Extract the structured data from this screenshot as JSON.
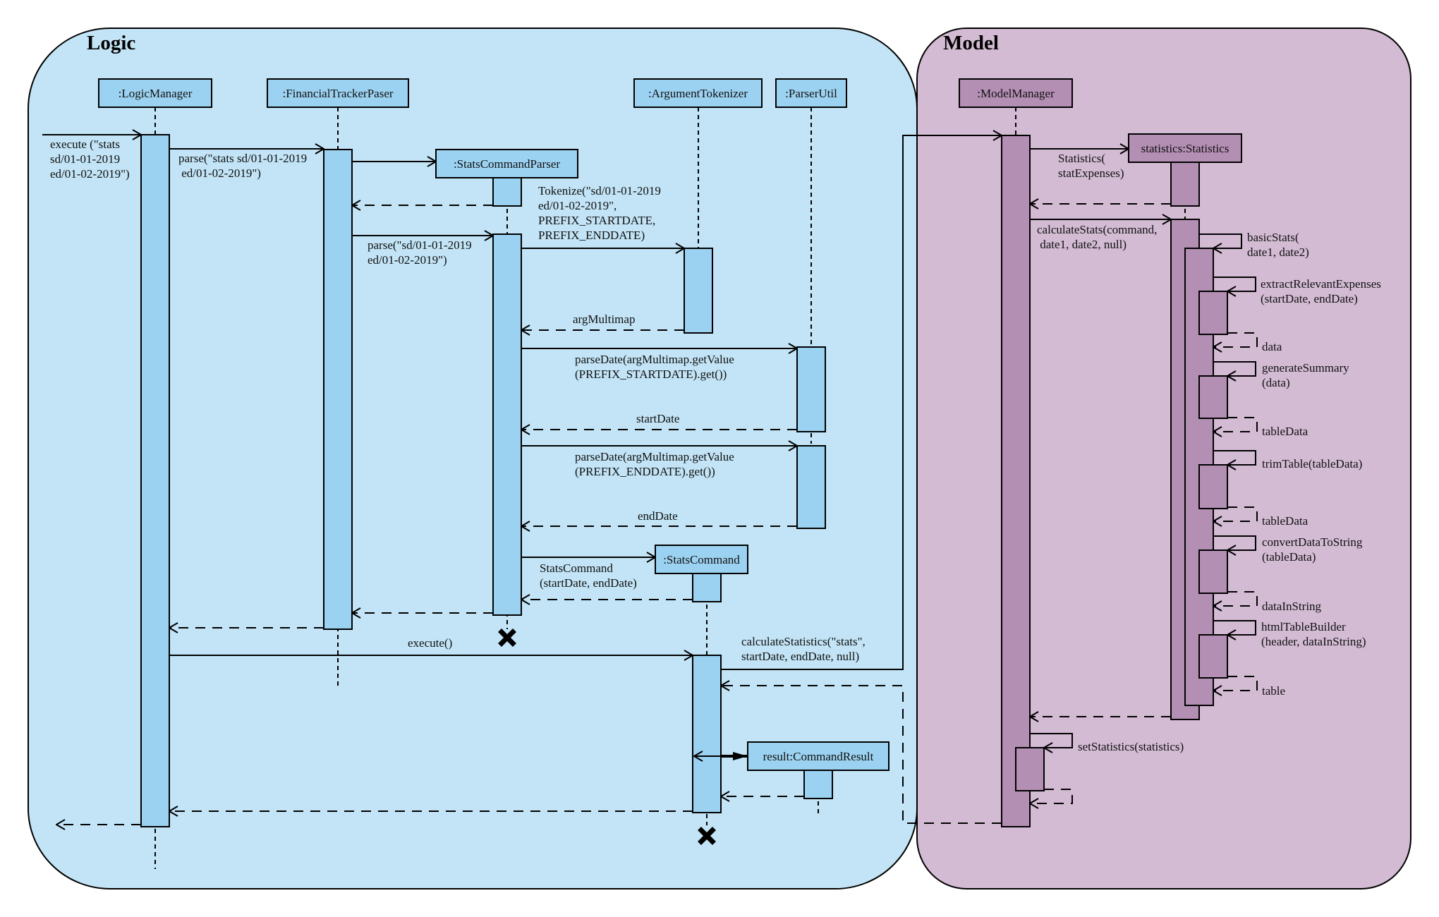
{
  "diagram": {
    "type": "sequence",
    "colors": {
      "logic_background": "#C2E4F6",
      "logic_element": "#9CD2F1",
      "model_background": "#D3BBD3",
      "model_element": "#B48FB4",
      "line": "#000000"
    },
    "frames": {
      "logic": {
        "title": "Logic"
      },
      "model": {
        "title": "Model"
      }
    },
    "participants": {
      "logic_manager": ":LogicManager",
      "financial_tracker_paser": ":FinancialTrackerPaser",
      "stats_command_parser": ":StatsCommandParser",
      "argument_tokenizer": ":ArgumentTokenizer",
      "parser_util": ":ParserUtil",
      "stats_command": ":StatsCommand",
      "command_result": "result:CommandResult",
      "model_manager": ":ModelManager",
      "statistics": "statistics:Statistics"
    },
    "messages": {
      "execute_in": [
        "execute (\"stats",
        "sd/01-01-2019",
        "ed/01-02-2019\")"
      ],
      "parse_full": [
        "parse(\"stats sd/01-01-2019",
        " ed/01-02-2019\")"
      ],
      "create_parser": [],
      "parser_created_return": [],
      "parse_args": [
        "parse(\"sd/01-01-2019",
        "ed/01-02-2019\")"
      ],
      "tokenize": [
        "Tokenize(\"sd/01-01-2019",
        "ed/01-02-2019\",",
        "PREFIX_STARTDATE,",
        "PREFIX_ENDDATE)"
      ],
      "arg_multimap_return": [
        "argMultimap"
      ],
      "parse_start_date": [
        "parseDate(argMultimap.getValue",
        "(PREFIX_STARTDATE).get())"
      ],
      "start_date_return": [
        "startDate"
      ],
      "parse_end_date": [
        "parseDate(argMultimap.getValue",
        "(PREFIX_ENDDATE).get())"
      ],
      "end_date_return": [
        "endDate"
      ],
      "create_stats_command": [
        "StatsCommand",
        "(startDate, endDate)"
      ],
      "stats_command_return": [],
      "parser_return": [],
      "paser_return": [],
      "execute_command": [
        "execute()"
      ],
      "calculate_statistics": [
        "calculateStatistics(\"stats\",",
        "startDate, endDate, null)"
      ],
      "create_statistics": [
        "Statistics(",
        "statExpenses)"
      ],
      "statistics_created_return": [],
      "calculate_stats": [
        "calculateStats(command,",
        " date1, date2, null)"
      ],
      "basic_stats": [
        "basicStats(",
        "date1, date2)"
      ],
      "extract_relevant_expenses": [
        "extractRelevantExpenses",
        "(startDate, endDate)"
      ],
      "data_return": [
        "data"
      ],
      "generate_summary": [
        "generateSummary",
        "(data)"
      ],
      "table_data_return_1": [
        "tableData"
      ],
      "trim_table": [
        "trimTable(tableData)"
      ],
      "table_data_return_2": [
        "tableData"
      ],
      "convert_data_to_string": [
        "convertDataToString",
        "(tableData)"
      ],
      "data_in_string_return": [
        "dataInString"
      ],
      "html_table_builder": [
        "htmlTableBuilder",
        "(header, dataInString)"
      ],
      "table_return": [
        "table"
      ],
      "calculate_stats_return": [],
      "set_statistics": [
        "setStatistics(statistics)"
      ],
      "set_statistics_return": [],
      "calculate_statistics_return": [],
      "create_command_result": [],
      "command_result_return": [],
      "command_return": [],
      "final_return": []
    }
  }
}
